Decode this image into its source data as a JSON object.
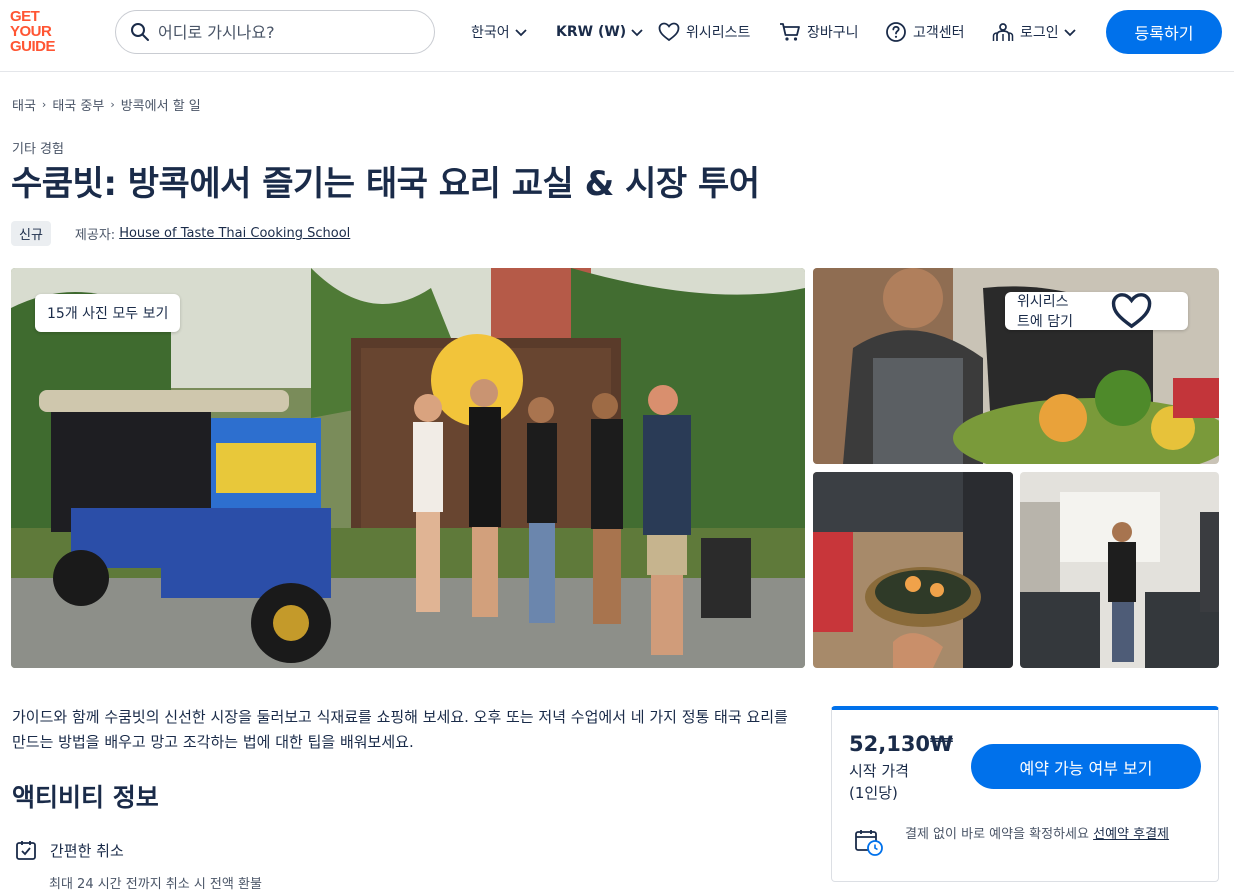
{
  "header": {
    "logo_lines": [
      "GET",
      "YOUR",
      "GUIDE"
    ],
    "search_placeholder": "어디로 가시나요?",
    "language": "한국어",
    "currency": "KRW (W)",
    "wishlist": "위시리스트",
    "cart": "장바구니",
    "help": "고객센터",
    "login": "로그인",
    "register": "등록하기"
  },
  "breadcrumb": [
    "태국",
    "태국 중부",
    "방콕에서 할 일"
  ],
  "category": "기타 경험",
  "title": "수쿰빗: 방콕에서 즐기는 태국 요리 교실 & 시장 투어",
  "badge": "신규",
  "provider_label": "제공자:",
  "provider_name": "House of Taste Thai Cooking School",
  "gallery": {
    "view_all": "15개 사진 모두 보기",
    "add_wishlist": "위시리스트에 담기"
  },
  "description": "가이드와 함께 수쿰빗의 신선한 시장을 둘러보고 식재료를 쇼핑해 보세요. 오후 또는 저녁 수업에서 네 가지 정통 태국 요리를 만드는 방법을 배우고 망고 조각하는 법에 대한 팁을 배워보세요.",
  "activity_info": {
    "title": "액티비티 정보",
    "features": [
      {
        "label": "간편한 취소",
        "sub": "최대 24 시간 전까지 취소 시 전액 환불",
        "icon": "calendar-check-icon"
      }
    ]
  },
  "booking": {
    "price": "52,130₩",
    "from_label": "시작 가격",
    "per_label": "(1인당)",
    "button": "예약 가능 여부 보기",
    "reserve_text": "결제 없이 바로 예약을 확정하세요 ",
    "reserve_link": "선예약 후결제"
  },
  "colors": {
    "brand": "#ff5533",
    "primary": "#0071eb",
    "text": "#1a2b49"
  }
}
